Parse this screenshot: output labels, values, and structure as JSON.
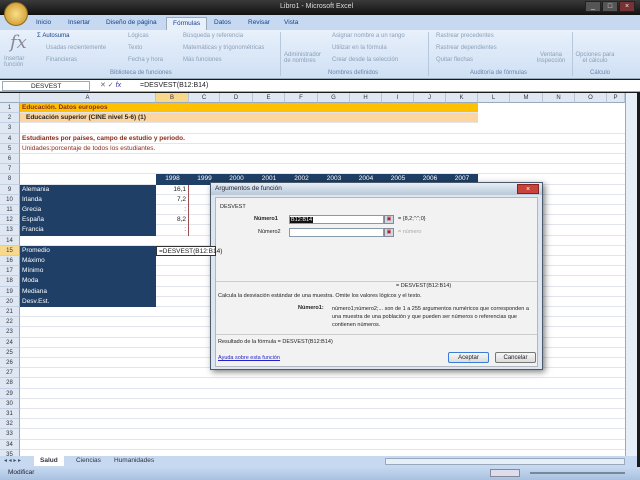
{
  "window": {
    "title": "Libro1 - Microsoft Excel"
  },
  "ribbon": {
    "tabs": [
      "Inicio",
      "Insertar",
      "Diseño de página",
      "Fórmulas",
      "Datos",
      "Revisar",
      "Vista"
    ],
    "active_tab": "Fórmulas",
    "insert_function": "Insertar función",
    "library": [
      "Autosuma",
      "Usadas recientemente",
      "Financieras",
      "Lógicas",
      "Texto",
      "Fecha y hora",
      "Búsqueda y referencia",
      "Matemáticas y trigonométricas",
      "Más funciones"
    ],
    "library_group": "Biblioteca de funciones",
    "names_manager": "Administrador de nombres",
    "names": [
      "Asignar nombre a un rango",
      "Utilizar en la fórmula",
      "Crear desde la selección"
    ],
    "names_group": "Nombres definidos",
    "audit": [
      "Rastrear precedentes",
      "Rastrear dependientes",
      "Quitar flechas"
    ],
    "audit_group": "Auditoría de fórmulas",
    "watch": "Ventana Inspección",
    "calc_options": "Opciones para el cálculo",
    "calc_group": "Cálculo"
  },
  "formula_bar": {
    "name_box": "DESVEST",
    "formula": "=DESVEST(B12:B14)"
  },
  "columns": [
    "A",
    "B",
    "C",
    "D",
    "E",
    "F",
    "G",
    "H",
    "I",
    "J",
    "K",
    "L",
    "M",
    "N",
    "O",
    "P"
  ],
  "cells": {
    "1": {
      "A": "Educación. Datos europeos"
    },
    "2": {
      "A": "Educación superior (CINE nivel 5-6) (1)"
    },
    "4": {
      "A": "Estudiantes por países, campo de estudio y periodo."
    },
    "5": {
      "A": "Unidades:porcentaje de todos los estudiantes."
    },
    "8": {
      "B": "1998",
      "C": "1999",
      "D": "2000",
      "E": "2001",
      "F": "2002",
      "G": "2003",
      "H": "2004",
      "I": "2005",
      "J": "2006",
      "K": "2007"
    },
    "9": {
      "A": "Alemania",
      "B": "16,1"
    },
    "10": {
      "A": "Irlanda",
      "B": "7,2"
    },
    "11": {
      "A": "Grecia",
      "B": ":"
    },
    "12": {
      "A": "España",
      "B": "8,2"
    },
    "13": {
      "A": "Francia",
      "B": ":"
    },
    "15": {
      "A": "Promedio",
      "B": "=DESVEST(B12:B14)"
    },
    "16": {
      "A": "Máximo"
    },
    "17": {
      "A": "Mínimo"
    },
    "18": {
      "A": "Moda"
    },
    "19": {
      "A": "Mediana"
    },
    "20": {
      "A": "Desv.Est."
    }
  },
  "sheet_tabs": [
    "Salud",
    "Ciencias",
    "Humanidades"
  ],
  "active_sheet": "Salud",
  "status": "Modificar",
  "dialog": {
    "title": "Argumentos de función",
    "function": "DESVEST",
    "arg1_label": "Número1",
    "arg1_value": "B12:B14",
    "arg1_result": "= {8,2;\":\";0}",
    "arg2_label": "Número2",
    "arg2_result": "= número",
    "overall": "= DESVEST(B12:B14)",
    "description": "Calcula la desviación estándar de una muestra. Omite los valores lógicos y el texto.",
    "arg_help_label": "Número1:",
    "arg_help": "número1;número2;... son de 1 a 255 argumentos numéricos que corresponden a una muestra de una población y que pueden ser números o referencias que contienen números.",
    "result": "Resultado de la fórmula =  DESVEST(B12:B14)",
    "help_link": "Ayuda sobre esta función",
    "ok": "Aceptar",
    "cancel": "Cancelar"
  },
  "colors": {
    "title_fill": "#ffc000",
    "subtitle_fill": "#fcd5a0",
    "header_fill": "#1f3f66",
    "text_red": "#8b2b1a"
  }
}
